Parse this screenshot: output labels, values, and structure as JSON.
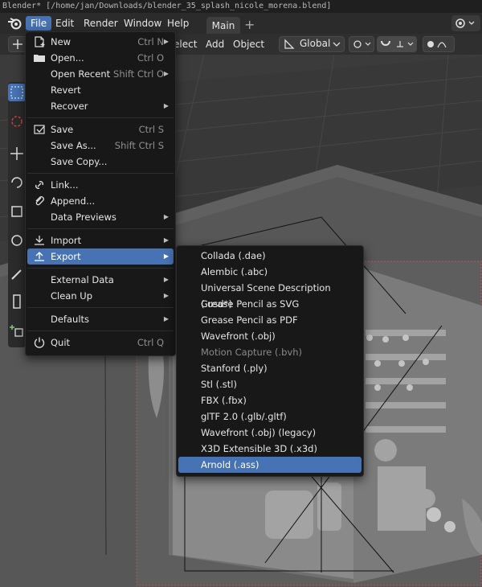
{
  "window": {
    "title": "Blender* [/home/jan/Downloads/blender_35_splash_nicole_morena.blend]"
  },
  "menubar": {
    "items": [
      "File",
      "Edit",
      "Render",
      "Window",
      "Help"
    ],
    "active": "File",
    "workspace_tab": "Main",
    "add_tab": "+"
  },
  "header": {
    "select_fragment": "elect",
    "add": "Add",
    "object": "Object",
    "orientation": "Global"
  },
  "file_menu": {
    "items": [
      {
        "label": "New",
        "shortcut": "Ctrl N",
        "submenu": true,
        "icon": "new-file-icon"
      },
      {
        "label": "Open...",
        "shortcut": "Ctrl O",
        "icon": "folder-icon"
      },
      {
        "label": "Open Recent",
        "shortcut": "Shift Ctrl O",
        "submenu": true
      },
      {
        "label": "Revert"
      },
      {
        "label": "Recover",
        "submenu": true
      },
      {
        "label": "Save",
        "shortcut": "Ctrl S",
        "icon": "save-icon"
      },
      {
        "label": "Save As...",
        "shortcut": "Shift Ctrl S"
      },
      {
        "label": "Save Copy..."
      },
      {
        "label": "Link...",
        "icon": "link-icon"
      },
      {
        "label": "Append...",
        "icon": "append-icon"
      },
      {
        "label": "Data Previews",
        "submenu": true
      },
      {
        "label": "Import",
        "submenu": true,
        "icon": "import-icon"
      },
      {
        "label": "Export",
        "submenu": true,
        "icon": "export-icon",
        "highlighted": true
      },
      {
        "label": "External Data",
        "submenu": true
      },
      {
        "label": "Clean Up",
        "submenu": true
      },
      {
        "label": "Defaults",
        "submenu": true
      },
      {
        "label": "Quit",
        "shortcut": "Ctrl Q",
        "icon": "power-icon"
      }
    ]
  },
  "export_menu": {
    "items": [
      {
        "label": "Collada (.dae)"
      },
      {
        "label": "Alembic (.abc)"
      },
      {
        "label": "Universal Scene Description (.usd*)"
      },
      {
        "label": "Grease Pencil as SVG"
      },
      {
        "label": "Grease Pencil as PDF"
      },
      {
        "label": "Wavefront (.obj)"
      },
      {
        "label": "Motion Capture (.bvh)",
        "disabled": true
      },
      {
        "label": "Stanford (.ply)"
      },
      {
        "label": "Stl (.stl)"
      },
      {
        "label": "FBX (.fbx)"
      },
      {
        "label": "glTF 2.0 (.glb/.gltf)"
      },
      {
        "label": "Wavefront (.obj) (legacy)"
      },
      {
        "label": "X3D Extensible 3D (.x3d)"
      },
      {
        "label": "Arnold (.ass)",
        "highlighted": true
      }
    ]
  },
  "colors": {
    "accent": "#4772b3",
    "menu_bg": "#181818",
    "viewport_bg": "#3d3d3d"
  }
}
